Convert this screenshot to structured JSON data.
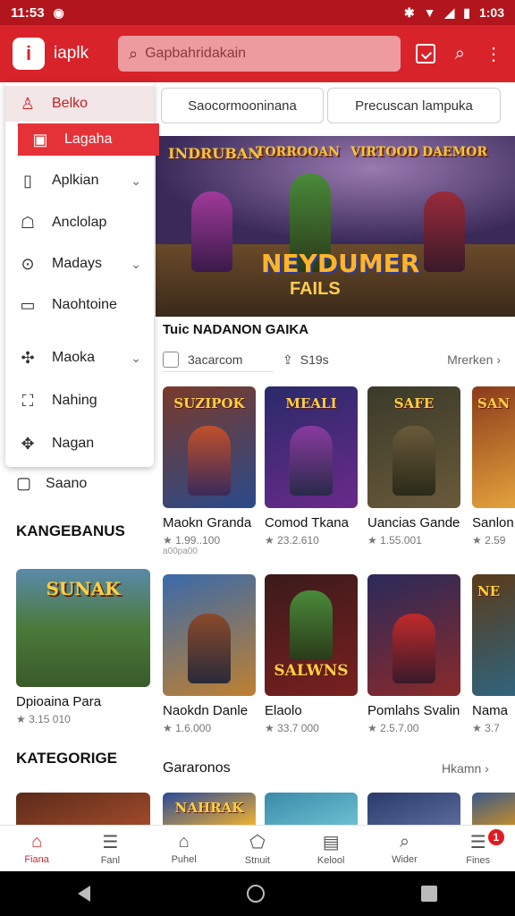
{
  "status": {
    "time": "11:53",
    "right_time": "1:03"
  },
  "appbar": {
    "logo": "i",
    "app_name": "iaplk",
    "search_placeholder": "Gapbahridakain"
  },
  "drawer": {
    "items": [
      {
        "label": "Belko",
        "icon": "person-icon"
      },
      {
        "label": "Lagaha",
        "icon": "image-icon"
      },
      {
        "label": "Aplkian",
        "icon": "app-icon",
        "expandable": true
      },
      {
        "label": "Anclolap",
        "icon": "user-card-icon"
      },
      {
        "label": "Madays",
        "icon": "location-icon",
        "expandable": true
      },
      {
        "label": "Naohtoine",
        "icon": "chart-icon"
      },
      {
        "label": "Maoka",
        "icon": "puzzle-icon",
        "expandable": true
      },
      {
        "label": "Nahing",
        "icon": "frame-icon"
      },
      {
        "label": "Nagan",
        "icon": "gamepad-icon"
      }
    ],
    "extra": "Saano"
  },
  "filters": [
    "Saocormooninana",
    "Precuscan lampuka"
  ],
  "banner": {
    "logos": [
      "INDRUBAN",
      "TORROOAN",
      "VIRTOOD",
      "DAEMOR"
    ],
    "title": "NEYDUMER",
    "subtitle": "FAILS"
  },
  "section1": {
    "title": "Tuic NADANON GAIKA",
    "sort_label": "3acarcom",
    "count_label": "S19s",
    "more_label": "Mrerken ›"
  },
  "row1": [
    {
      "title": "SUZIPOK",
      "name": "Maokn Granda",
      "meta": "★ 1.99..100",
      "meta2": "a00pa00",
      "colors": [
        "#7a3a2a",
        "#2a4a8a",
        "#c0502a"
      ]
    },
    {
      "title": "MEALI",
      "name": "Comod Tkana",
      "meta": "★ 23.2.610",
      "colors": [
        "#2a2a6a",
        "#6a2a8a",
        "#e0c040"
      ]
    },
    {
      "title": "SAFE",
      "name": "Uancias Gande",
      "meta": "★ 1.55.001",
      "colors": [
        "#3a3a2a",
        "#6a5a3a",
        "#c09a40"
      ]
    },
    {
      "title": "SAN",
      "name": "Sanlon",
      "meta": "★ 2.59",
      "colors": [
        "#8a3a1a",
        "#c0602a",
        "#f0b040"
      ]
    }
  ],
  "left_section": {
    "heading": "KANGEBANUS",
    "card_title": "SUNAK",
    "name": "Dpioaina Para",
    "meta": "★ 3.15 010"
  },
  "row2": [
    {
      "title": "",
      "name": "Naokdn Danle",
      "meta": "★ 1.6.000",
      "colors": [
        "#3a6aaa",
        "#c08030",
        "#f0c060"
      ]
    },
    {
      "title": "SALWNS",
      "name": "Elaolo",
      "meta": "★ 33.7 000",
      "colors": [
        "#3a1a1a",
        "#7a2020",
        "#f0c040"
      ]
    },
    {
      "title": "",
      "name": "Pomlahs Svalin",
      "meta": "★ 2.5.7.00",
      "colors": [
        "#2a2a5a",
        "#8a2a2a",
        "#c0a040"
      ]
    },
    {
      "title": "NE",
      "name": "Nama",
      "meta": "★ 3.7",
      "colors": [
        "#5a3a1a",
        "#2a6a8a",
        "#f0b030"
      ]
    }
  ],
  "section2": {
    "title": "Gararonos",
    "more_label": "Hkamn ›"
  },
  "left_section2": {
    "heading": "KATEGORIGE"
  },
  "row3": [
    {
      "title": "",
      "colors": [
        "#5a2a1a",
        "#a04a2a"
      ]
    },
    {
      "title": "NAHRAK",
      "colors": [
        "#2a4a9a",
        "#f0b030"
      ]
    },
    {
      "title": "",
      "colors": [
        "#3a8aaa",
        "#6ac0d0"
      ]
    },
    {
      "title": "",
      "colors": [
        "#2a3a6a",
        "#5a6a9a"
      ]
    }
  ],
  "bottom_nav": [
    {
      "label": "Fiana",
      "icon": "home-icon",
      "active": true
    },
    {
      "label": "Fanl",
      "icon": "stack-icon"
    },
    {
      "label": "Puhel",
      "icon": "house-outline-icon"
    },
    {
      "label": "Stnuit",
      "icon": "tag-icon"
    },
    {
      "label": "Kelool",
      "icon": "calendar-icon"
    },
    {
      "label": "Wider",
      "icon": "search-icon"
    },
    {
      "label": "Fines",
      "icon": "menu-icon",
      "badge": "1"
    }
  ],
  "colors": {
    "brand": "#d8232a",
    "status_bar": "#b3151c"
  }
}
